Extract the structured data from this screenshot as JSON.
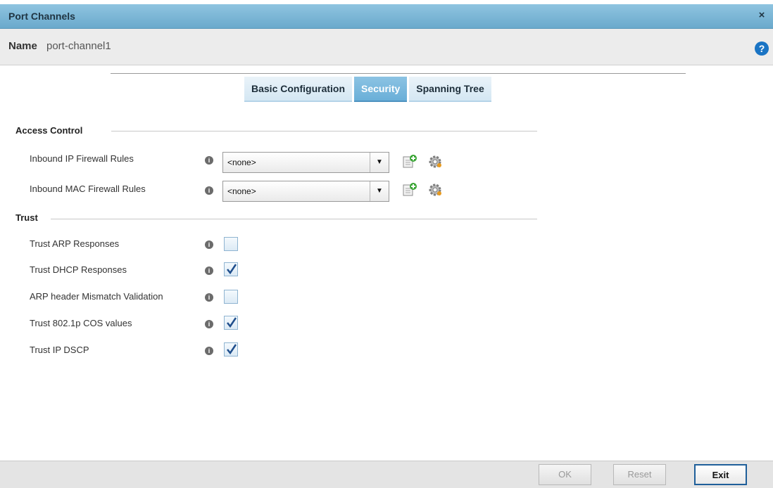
{
  "window": {
    "title": "Port Channels",
    "close_label": "×"
  },
  "name_bar": {
    "label": "Name",
    "value": "port-channel1",
    "help_label": "?"
  },
  "tabs": [
    {
      "label": "Basic Configuration",
      "active": false
    },
    {
      "label": "Security",
      "active": true
    },
    {
      "label": "Spanning Tree",
      "active": false
    }
  ],
  "access_control": {
    "title": "Access Control",
    "rows": [
      {
        "label": "Inbound IP Firewall Rules",
        "value": "<none>"
      },
      {
        "label": "Inbound MAC Firewall Rules",
        "value": "<none>"
      }
    ]
  },
  "trust": {
    "title": "Trust",
    "rows": [
      {
        "label": "Trust ARP Responses",
        "checked": false
      },
      {
        "label": "Trust DHCP Responses",
        "checked": true
      },
      {
        "label": "ARP header Mismatch Validation",
        "checked": false
      },
      {
        "label": "Trust 802.1p COS values",
        "checked": true
      },
      {
        "label": "Trust IP DSCP",
        "checked": true
      }
    ]
  },
  "footer": {
    "ok_label": "OK",
    "reset_label": "Reset",
    "exit_label": "Exit"
  },
  "icons": {
    "info": "info-icon",
    "dropdown": "chevron-down-icon",
    "create": "create-new-icon",
    "edit": "gear-icon",
    "check": "checkmark-icon"
  },
  "colors": {
    "title_bar": "#7ab6d8",
    "active_tab": "#7bb9de",
    "help": "#1a74c4",
    "exit_border": "#1f5f9a"
  }
}
